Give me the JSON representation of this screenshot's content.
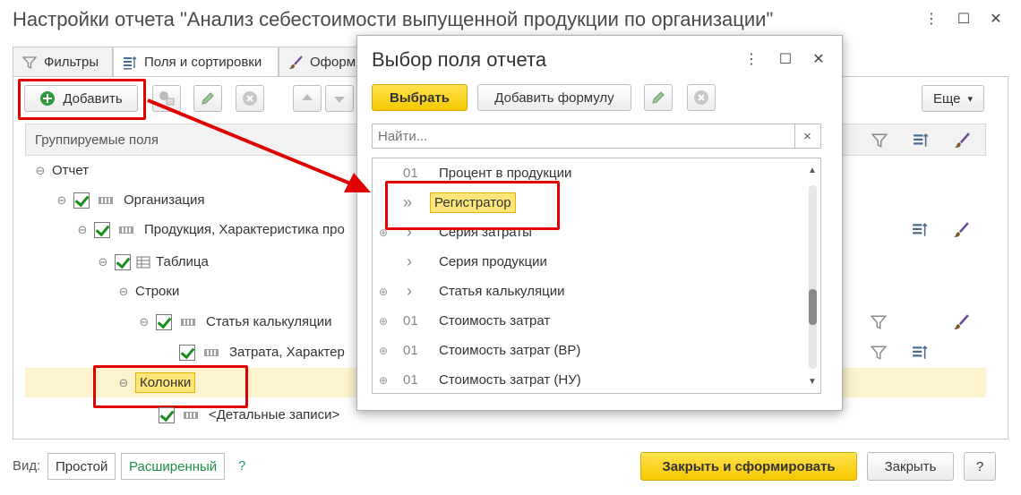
{
  "window": {
    "title": "Настройки отчета \"Анализ себестоимости выпущенной продукции по организации\"",
    "more_icon": "⋮",
    "maximize_icon": "☐",
    "close_icon": "✕"
  },
  "tabs": [
    {
      "label": "Фильтры",
      "icon": "filter-icon"
    },
    {
      "label": "Поля и сортировки",
      "icon": "fields-sort-icon"
    },
    {
      "label": "Оформ",
      "icon": "brush-icon"
    }
  ],
  "toolbar": {
    "add_label": "Добавить",
    "more_label": "Еще",
    "more_arrow": "▾"
  },
  "grid": {
    "header": "Группируемые поля",
    "rows": [
      {
        "label": "Отчет",
        "toggle": "⊖"
      },
      {
        "label": "Организация",
        "toggle": "⊖"
      },
      {
        "label": "Продукция, Характеристика про",
        "toggle": "⊖"
      },
      {
        "label": "Таблица",
        "toggle": "⊖"
      },
      {
        "label": "Строки",
        "toggle": "⊖"
      },
      {
        "label": "Статья калькуляции",
        "toggle": "⊖"
      },
      {
        "label": "Затрата, Характер",
        "toggle": ""
      },
      {
        "label": "Колонки",
        "toggle": "⊖"
      },
      {
        "label": "<Детальные записи>",
        "toggle": ""
      }
    ]
  },
  "bottom": {
    "view_label": "Вид:",
    "simple_label": "Простой",
    "extended_label": "Расширенный",
    "help_link": "?",
    "close_and_build_label": "Закрыть и сформировать",
    "close_label": "Закрыть",
    "help_button": "?"
  },
  "dialog": {
    "title": "Выбор поля отчета",
    "more_icon": "⋮",
    "maximize_icon": "☐",
    "close_icon": "✕",
    "select_label": "Выбрать",
    "add_formula_label": "Добавить формулу",
    "search_placeholder": "Найти...",
    "search_clear": "×",
    "items": [
      {
        "expand": "",
        "type": "01",
        "label": "Процент в продукции"
      },
      {
        "expand": "",
        "type": "»",
        "label": "Регистратор"
      },
      {
        "expand": "⊕",
        "type": "›",
        "label": "Серия затраты"
      },
      {
        "expand": "",
        "type": "›",
        "label": "Серия продукции"
      },
      {
        "expand": "⊕",
        "type": "›",
        "label": "Статья калькуляции"
      },
      {
        "expand": "⊕",
        "type": "01",
        "label": "Стоимость затрат"
      },
      {
        "expand": "⊕",
        "type": "01",
        "label": "Стоимость затрат (ВР)"
      },
      {
        "expand": "⊕",
        "type": "01",
        "label": "Стоимость затрат (НУ)"
      }
    ],
    "scroll_up": "▲",
    "scroll_down": "▼"
  },
  "colors": {
    "accent_yellow": "#f5c800",
    "selected_row": "#fdf3cf",
    "highlight_box": "#e00000",
    "check_green": "#1a8e1a",
    "link_green": "#1a8e4a"
  }
}
